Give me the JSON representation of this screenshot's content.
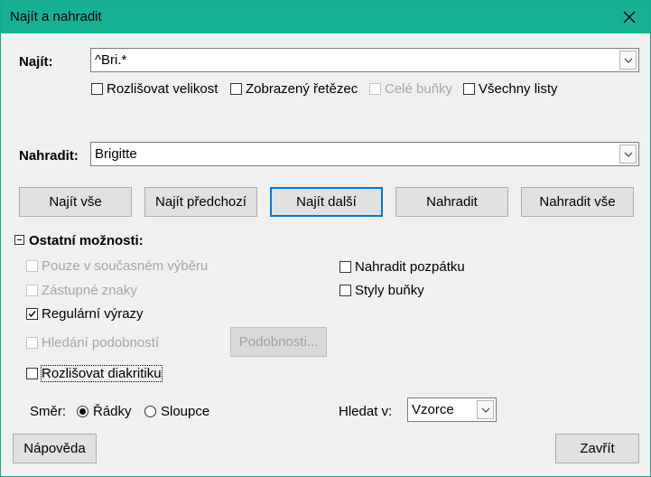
{
  "window": {
    "title": "Najít a nahradit"
  },
  "find": {
    "label": "Najít:",
    "value": "^Bri.*",
    "options": [
      {
        "label": "Rozlišovat velikost",
        "checked": false,
        "enabled": true
      },
      {
        "label": "Zobrazený řetězec",
        "checked": false,
        "enabled": true
      },
      {
        "label": "Celé buňky",
        "checked": false,
        "enabled": false
      },
      {
        "label": "Všechny listy",
        "checked": false,
        "enabled": true
      }
    ]
  },
  "replace": {
    "label": "Nahradit:",
    "value": "Brigitte"
  },
  "buttons": {
    "find_all": "Najít vše",
    "find_prev": "Najít předchozí",
    "find_next": "Najít další",
    "replace": "Nahradit",
    "replace_all": "Nahradit vše"
  },
  "other": {
    "label": "Ostatní možnosti:",
    "left": [
      {
        "label": "Pouze v současném výběru",
        "checked": false,
        "enabled": false
      },
      {
        "label": "Zástupné znaky",
        "checked": false,
        "enabled": false
      },
      {
        "label": "Regulární výrazy",
        "checked": true,
        "enabled": true
      },
      {
        "label": "Hledání podobností",
        "checked": false,
        "enabled": false
      },
      {
        "label": "Rozlišovat diakritiku",
        "checked": false,
        "enabled": true
      }
    ],
    "right": [
      {
        "label": "Nahradit pozpátku",
        "checked": false,
        "enabled": true
      },
      {
        "label": "Styly buňky",
        "checked": false,
        "enabled": true
      }
    ],
    "similarity_button": "Podobnosti...",
    "direction": {
      "label": "Směr:",
      "rows": "Řádky",
      "columns": "Sloupce",
      "selected": "rows"
    },
    "search_in": {
      "label": "Hledat v:",
      "value": "Vzorce"
    }
  },
  "footer": {
    "help": "Nápověda",
    "close": "Zavřít"
  }
}
